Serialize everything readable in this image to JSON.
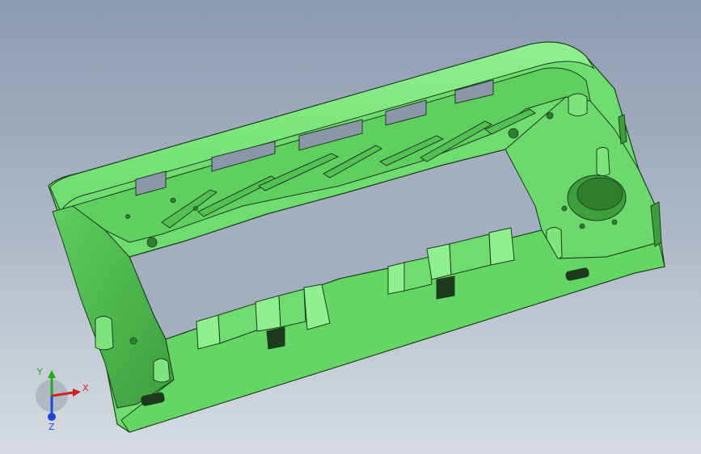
{
  "viewport": {
    "name": "cad-3d-viewport",
    "model": "green-plastic-housing-frame"
  },
  "triad": {
    "x_label": "X",
    "y_label": "Y",
    "z_label": "Z",
    "colors": {
      "x": "#d02020",
      "y": "#22aa22",
      "z": "#2244dd"
    }
  },
  "colors": {
    "background_top": "#8d9bb0",
    "background_bottom": "#d7dce3",
    "part_main": "#6edc6e",
    "part_light": "#8ff08f",
    "part_dark": "#3d9e3d",
    "edge": "#1c3d1c"
  }
}
